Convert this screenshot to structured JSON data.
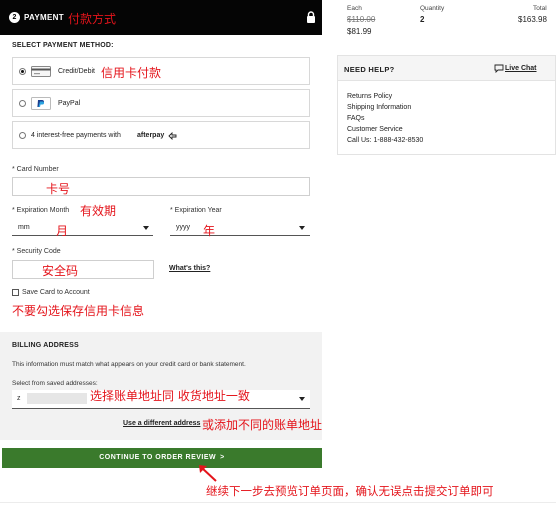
{
  "payment": {
    "step": "2",
    "title": "PAYMENT",
    "title_annotation": "付款方式",
    "select_label": "SELECT PAYMENT METHOD:",
    "options": [
      {
        "label": "Credit/Debit",
        "annotation": "信用卡付款",
        "checked": true
      },
      {
        "label": "PayPal",
        "checked": false
      },
      {
        "label": "4 interest-free payments with",
        "brand": "afterpay",
        "checked": false
      }
    ],
    "card_number_label": "* Card Number",
    "card_number_annotation": "卡号",
    "exp_month_label": "* Expiration Month",
    "exp_month_annotation": "有效期",
    "exp_month_value": "mm",
    "exp_month_value_annotation": "月",
    "exp_year_label": "* Expiration Year",
    "exp_year_value": "yyyy",
    "exp_year_value_annotation": "年",
    "security_code_label": "* Security Code",
    "security_code_annotation": "安全码",
    "whats_this": "What's this?",
    "save_card_label": "Save Card to Account",
    "save_card_annotation": "不要勾选保存信用卡信息"
  },
  "billing": {
    "title": "BILLING ADDRESS",
    "note": "This information must match what appears on your credit card or bank statement.",
    "saved_label": "Select from saved addresses:",
    "saved_value": "z",
    "saved_annotation": "选择账单地址同 收货地址一致",
    "different_link": "Use a different address",
    "different_annotation": "或添加不同的账单地址"
  },
  "continue": {
    "label": "CONTINUE TO ORDER REVIEW",
    "chevron": ">",
    "annotation": "继续下一步去预览订单页面，确认无误点击提交订单即可"
  },
  "order_summary": {
    "each_label": "Each",
    "quantity_label": "Quantity",
    "total_label": "Total",
    "orig_price": "$110.00",
    "sale_price": "$81.99",
    "quantity": "2",
    "total": "$163.98"
  },
  "help": {
    "title": "NEED HELP?",
    "live_chat": "Live Chat",
    "links": [
      "Returns Policy",
      "Shipping Information",
      "FAQs",
      "Customer Service",
      "Call Us: 1-888-432-8530"
    ]
  },
  "colors": {
    "header_bg": "#050505",
    "annotation_red": "#e4141b",
    "continue_green": "#3a7a2c",
    "billing_bg": "#f2f2f2"
  },
  "icons": [
    "lock-icon",
    "credit-card-icon",
    "paypal-icon",
    "afterpay-icon",
    "chat-icon",
    "caret-down-icon",
    "checkbox-icon",
    "arrow-icon"
  ]
}
